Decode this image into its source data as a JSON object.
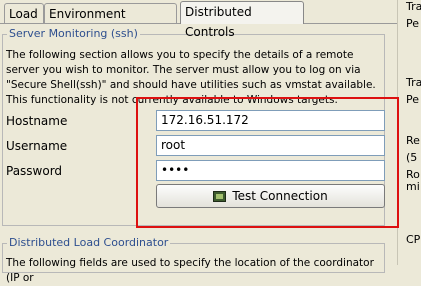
{
  "tabs": [
    {
      "label": "Load"
    },
    {
      "label": "Environment Variables"
    },
    {
      "label": "Distributed Controls"
    }
  ],
  "server_monitoring": {
    "legend": "Server Monitoring (ssh)",
    "description": "The following section allows you to specify the details of a remote server you wish to monitor. The server must allow you to log on via \"Secure Shell(ssh)\" and should have utilities such as vmstat available. This functionality is not currently available to Windows targets.",
    "hostname_label": "Hostname",
    "hostname_value": "172.16.51.172",
    "username_label": "Username",
    "username_value": "root",
    "password_label": "Password",
    "password_value": "••••",
    "test_button_label": "Test Connection"
  },
  "distributed_coordinator": {
    "legend": "Distributed Load Coordinator",
    "description": "The following fields are used to specify the location of the coordinator (IP or"
  },
  "right_strip": [
    "Tra",
    "Pe",
    "Tra",
    "Pe",
    "Re",
    "(5",
    "Ro",
    "mi",
    "CP"
  ],
  "colors": {
    "highlight": "#dd1010",
    "legend": "#2e4f8f"
  }
}
